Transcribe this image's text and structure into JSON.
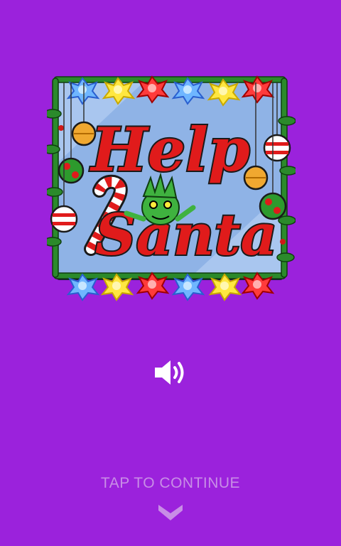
{
  "logo": {
    "title_line1": "Help",
    "title_line2": "Santa",
    "icon": "help-santa-logo"
  },
  "sound": {
    "icon": "speaker-sound-on-icon",
    "state": "on"
  },
  "prompt": {
    "text": "TAP TO CONTINUE",
    "icon": "chevron-down-icon"
  },
  "colors": {
    "background": "#9b22dc",
    "prompt_text": "#c88ee6",
    "title_red": "#e01b1b",
    "frame_blue": "#8fb3e6",
    "garland_green": "#2b8a2b"
  }
}
